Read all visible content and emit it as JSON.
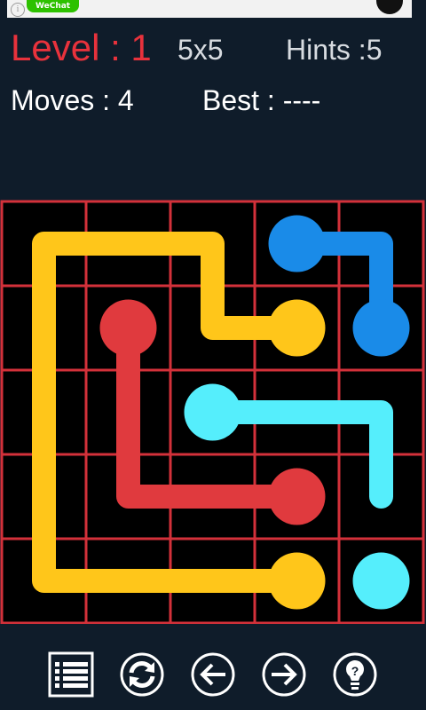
{
  "ad": {
    "label": "WeChat",
    "info": "i"
  },
  "hud": {
    "level": "Level : 1",
    "grid_size": "5x5",
    "hints": "Hints :5",
    "moves": "Moves : 4",
    "best": "Best : ----"
  },
  "board": {
    "rows": 5,
    "cols": 5,
    "grid_color": "#d3313a",
    "cell_bg": "#000000",
    "flows": [
      {
        "color": "#ffc61a",
        "path": [
          [
            0,
            3
          ],
          [
            0,
            2
          ],
          [
            0,
            1
          ],
          [
            0,
            0
          ],
          [
            1,
            0
          ],
          [
            2,
            0
          ],
          [
            3,
            0
          ],
          [
            4,
            0
          ],
          [
            4,
            1
          ],
          [
            4,
            2
          ],
          [
            4,
            3
          ]
        ],
        "endpoints": [
          [
            1,
            3
          ],
          [
            4,
            3
          ]
        ],
        "drawn_path": [
          [
            1,
            3
          ],
          [
            1,
            2
          ],
          [
            0,
            2
          ],
          [
            0,
            0
          ],
          [
            4,
            0
          ],
          [
            4,
            3
          ]
        ]
      },
      {
        "color": "#1a8be8",
        "endpoints": [
          [
            0,
            3
          ],
          [
            1,
            4
          ]
        ],
        "drawn_path": [
          [
            0,
            3
          ],
          [
            0,
            4
          ],
          [
            1,
            4
          ]
        ]
      },
      {
        "color": "#e03a3e",
        "endpoints": [
          [
            1,
            1
          ],
          [
            3,
            3
          ]
        ],
        "drawn_path": [
          [
            1,
            1
          ],
          [
            3,
            1
          ],
          [
            3,
            3
          ]
        ]
      },
      {
        "color": "#55eefc",
        "endpoints": [
          [
            2,
            2
          ],
          [
            4,
            4
          ]
        ],
        "drawn_path": [
          [
            2,
            2
          ],
          [
            2,
            4
          ],
          [
            3,
            4
          ]
        ]
      }
    ]
  },
  "toolbar": {
    "buttons": [
      "menu-list",
      "restart",
      "previous",
      "next",
      "hint"
    ]
  }
}
